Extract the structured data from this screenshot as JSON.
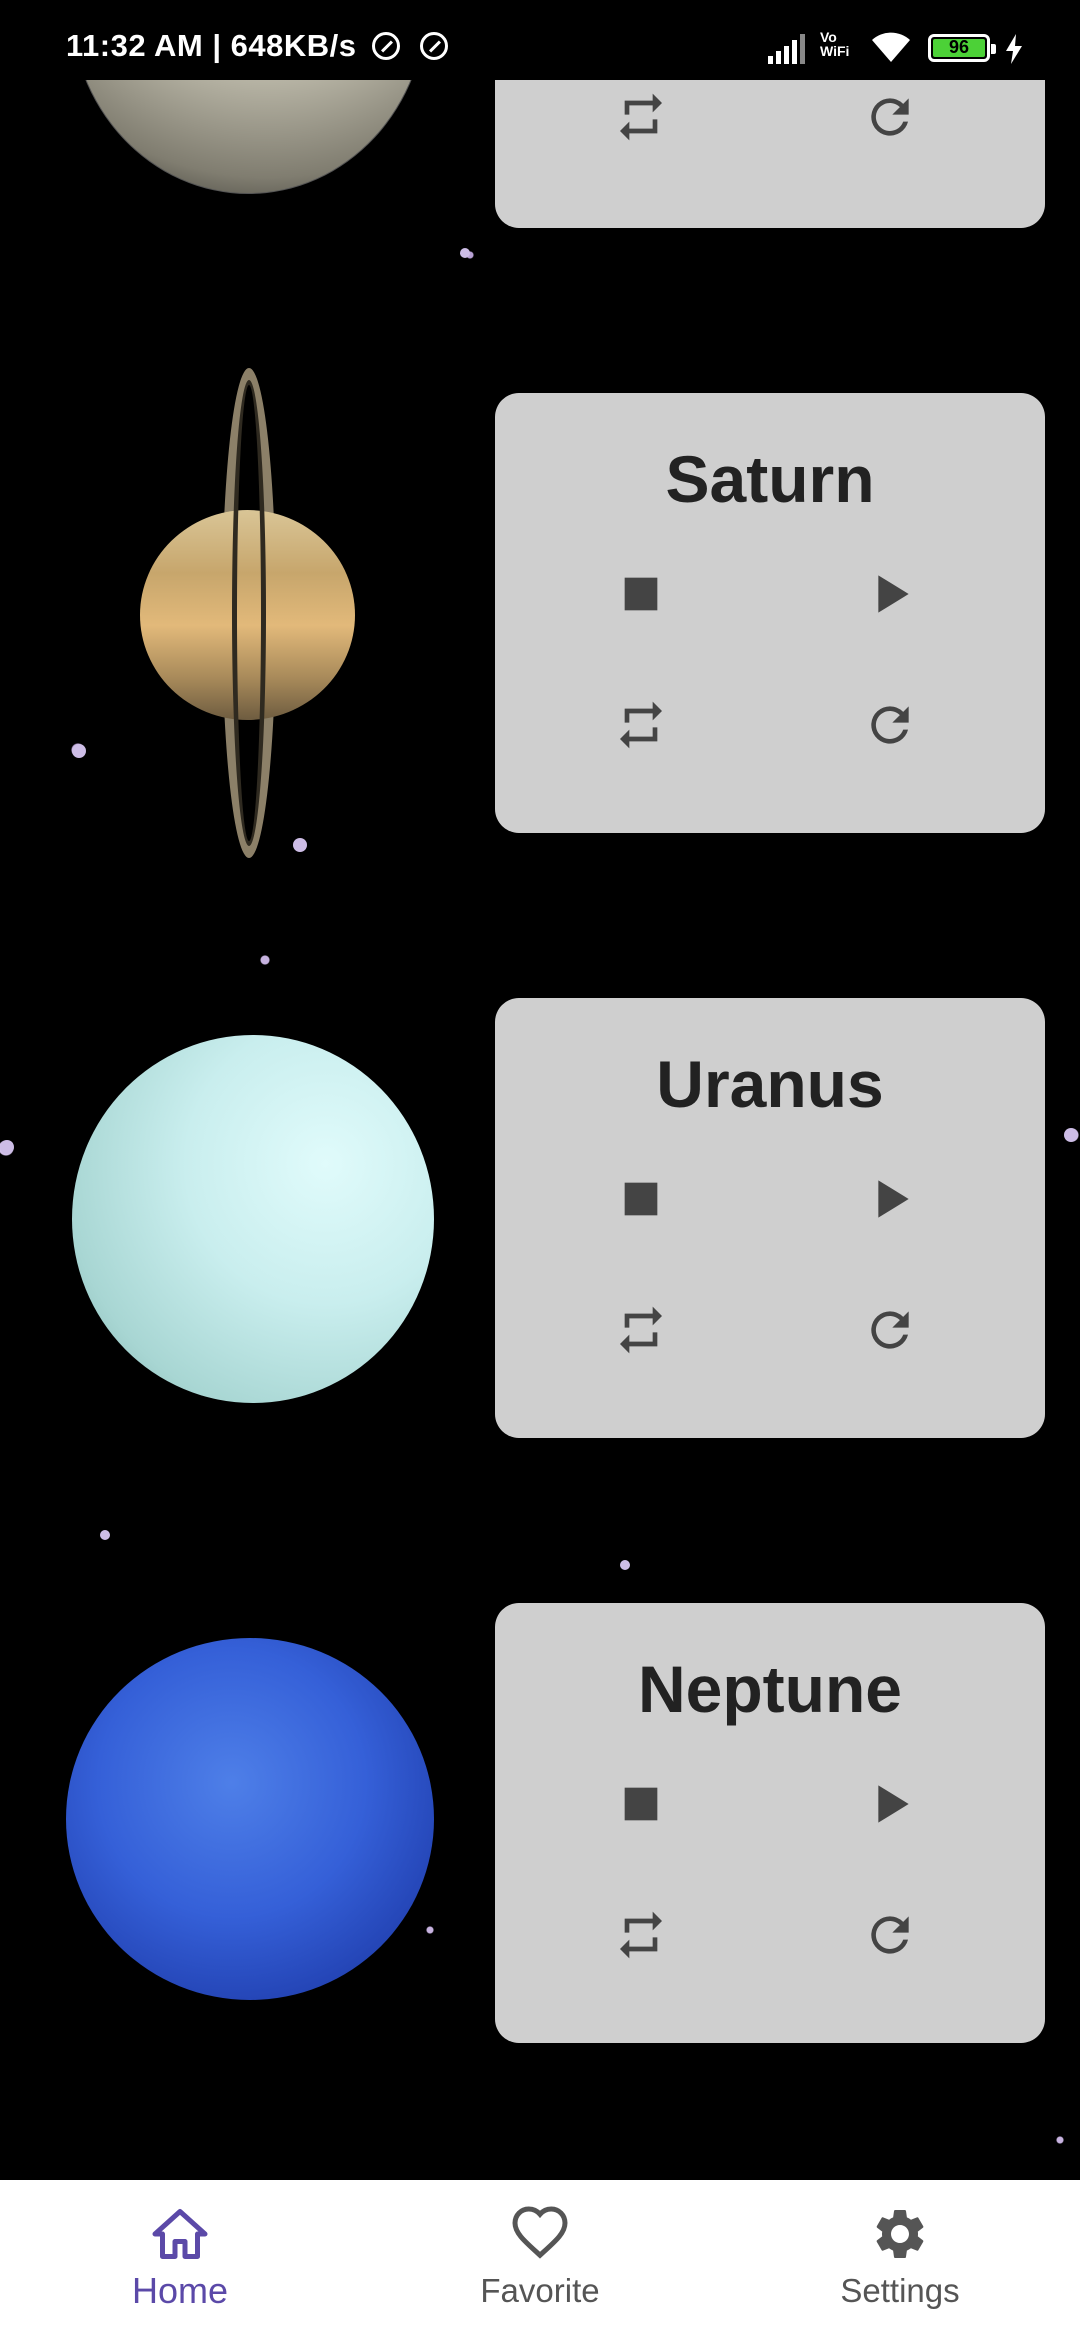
{
  "status_bar": {
    "time": "11:32 AM | 648KB/s",
    "network_label": "Vo WiFi",
    "battery_level": "96",
    "icons": [
      "data-saver-icon",
      "data-saver-icon",
      "signal-icon",
      "wifi-icon",
      "battery-icon",
      "charging-icon"
    ]
  },
  "planets": [
    {
      "name": "Saturn"
    },
    {
      "name": "Uranus"
    },
    {
      "name": "Neptune"
    }
  ],
  "controls": [
    "stop-icon",
    "play-icon",
    "repeat-icon",
    "replay-icon"
  ],
  "colors": {
    "card_bg": "#cfcfcf",
    "nav_active": "#5b49a8",
    "nav_inactive": "#555555",
    "background": "#000000"
  },
  "bottom_nav": {
    "items": [
      {
        "label": "Home",
        "icon": "home-icon",
        "active": true
      },
      {
        "label": "Favorite",
        "icon": "heart-icon",
        "active": false
      },
      {
        "label": "Settings",
        "icon": "gear-icon",
        "active": false
      }
    ]
  }
}
